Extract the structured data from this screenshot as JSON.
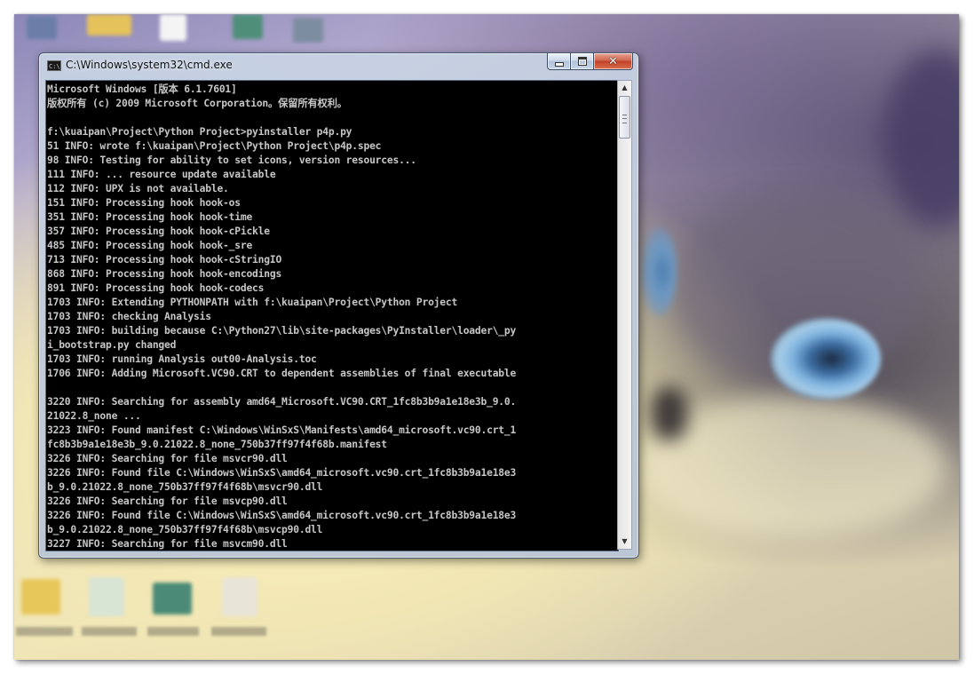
{
  "window": {
    "title": "C:\\Windows\\system32\\cmd.exe",
    "icon_label": "C:\\",
    "close_glyph": "✕"
  },
  "console": {
    "lines": [
      "Microsoft Windows [版本 6.1.7601]",
      "版权所有 (c) 2009 Microsoft Corporation。保留所有权利。",
      "",
      "f:\\kuaipan\\Project\\Python Project>pyinstaller p4p.py",
      "51 INFO: wrote f:\\kuaipan\\Project\\Python Project\\p4p.spec",
      "98 INFO: Testing for ability to set icons, version resources...",
      "111 INFO: ... resource update available",
      "112 INFO: UPX is not available.",
      "151 INFO: Processing hook hook-os",
      "351 INFO: Processing hook hook-time",
      "357 INFO: Processing hook hook-cPickle",
      "485 INFO: Processing hook hook-_sre",
      "713 INFO: Processing hook hook-cStringIO",
      "868 INFO: Processing hook hook-encodings",
      "891 INFO: Processing hook hook-codecs",
      "1703 INFO: Extending PYTHONPATH with f:\\kuaipan\\Project\\Python Project",
      "1703 INFO: checking Analysis",
      "1703 INFO: building because C:\\Python27\\lib\\site-packages\\PyInstaller\\loader\\_py",
      "i_bootstrap.py changed",
      "1703 INFO: running Analysis out00-Analysis.toc",
      "1706 INFO: Adding Microsoft.VC90.CRT to dependent assemblies of final executable",
      "",
      "3220 INFO: Searching for assembly amd64_Microsoft.VC90.CRT_1fc8b3b9a1e18e3b_9.0.",
      "21022.8_none ...",
      "3223 INFO: Found manifest C:\\Windows\\WinSxS\\Manifests\\amd64_microsoft.vc90.crt_1",
      "fc8b3b9a1e18e3b_9.0.21022.8_none_750b37ff97f4f68b.manifest",
      "3226 INFO: Searching for file msvcr90.dll",
      "3226 INFO: Found file C:\\Windows\\WinSxS\\amd64_microsoft.vc90.crt_1fc8b3b9a1e18e3",
      "b_9.0.21022.8_none_750b37ff97f4f68b\\msvcr90.dll",
      "3226 INFO: Searching for file msvcp90.dll",
      "3226 INFO: Found file C:\\Windows\\WinSxS\\amd64_microsoft.vc90.crt_1fc8b3b9a1e18e3",
      "b_9.0.21022.8_none_750b37ff97f4f68b\\msvcp90.dll",
      "3227 INFO: Searching for file msvcm90.dll"
    ]
  },
  "scrollbar": {
    "up_glyph": "▲",
    "down_glyph": "▼"
  },
  "colors": {
    "console_bg": "#000000",
    "console_text": "#c0c0c0",
    "close_button": "#c7432c"
  }
}
